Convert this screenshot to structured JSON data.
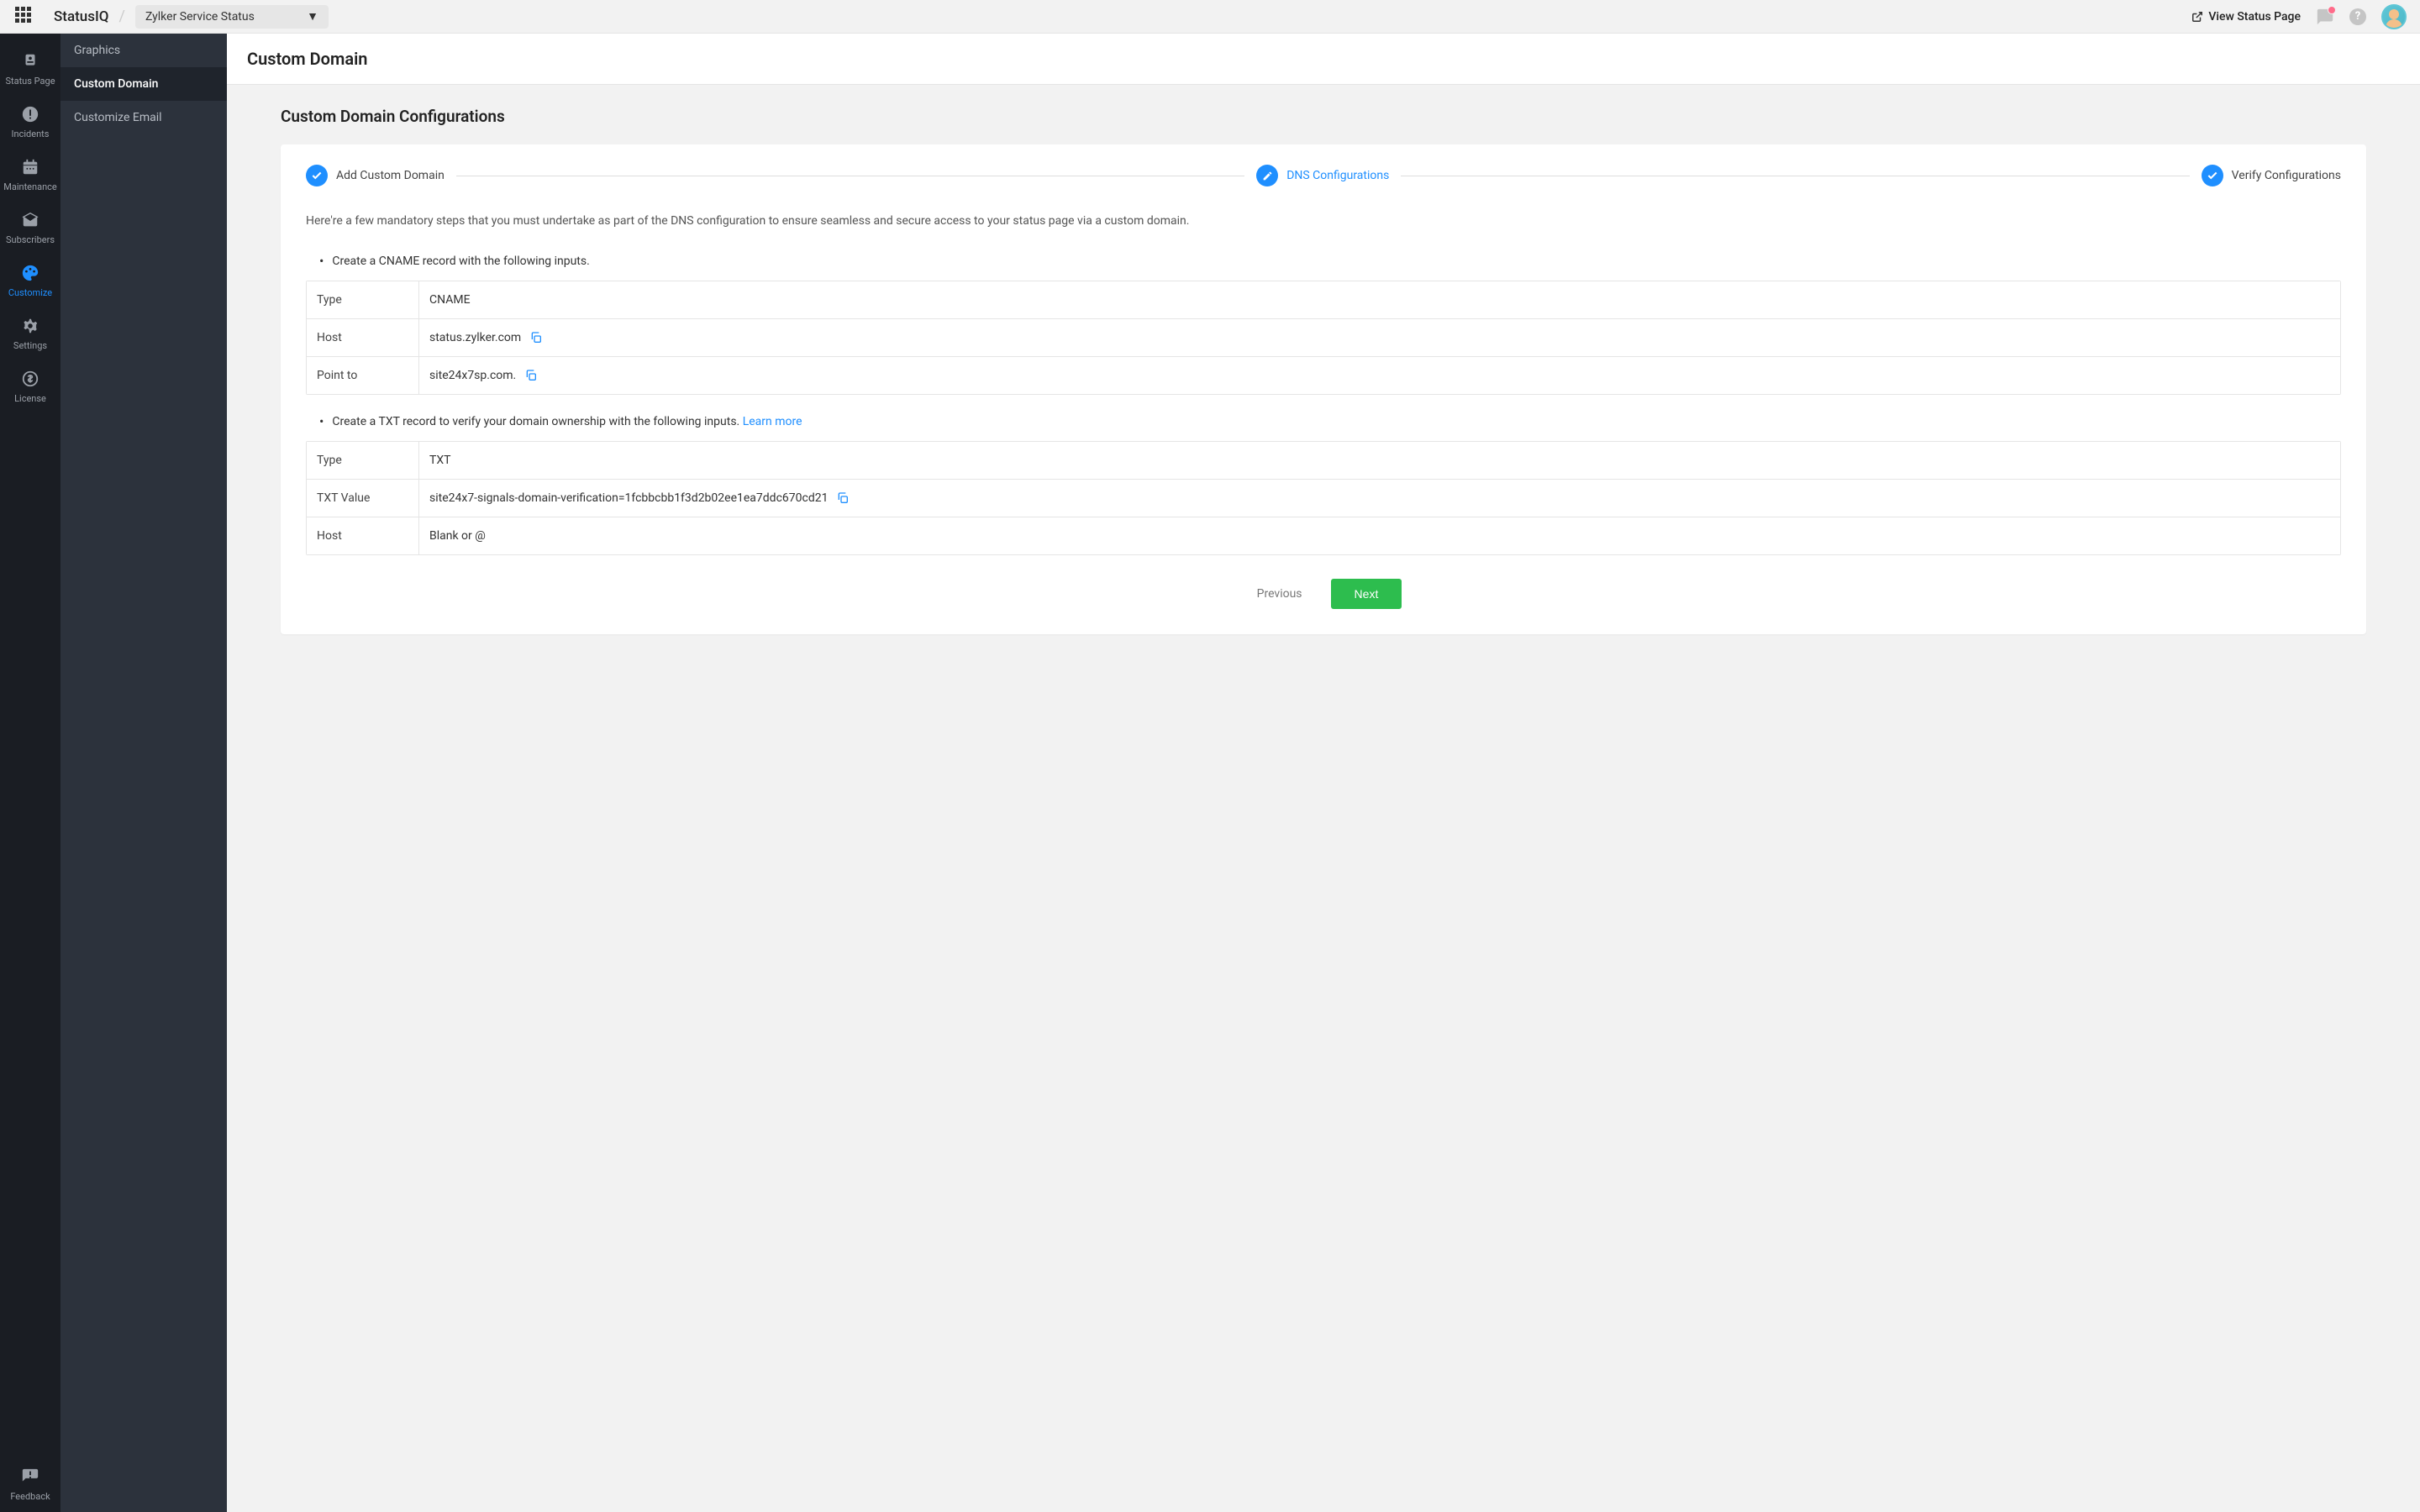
{
  "topbar": {
    "brand": "StatusIQ",
    "page_select": "Zylker Service Status",
    "view_link": "View Status Page"
  },
  "sidebar": {
    "items": [
      {
        "label": "Status Page"
      },
      {
        "label": "Incidents"
      },
      {
        "label": "Maintenance"
      },
      {
        "label": "Subscribers"
      },
      {
        "label": "Customize"
      },
      {
        "label": "Settings"
      },
      {
        "label": "License"
      }
    ],
    "feedback": "Feedback"
  },
  "subnav": {
    "items": [
      "Graphics",
      "Custom Domain",
      "Customize Email"
    ]
  },
  "main": {
    "title": "Custom Domain",
    "section_title": "Custom Domain Configurations",
    "steps": [
      "Add Custom Domain",
      "DNS Configurations",
      "Verify Configurations"
    ],
    "intro": "Here're a few mandatory steps that you must undertake as part of the DNS configuration to ensure seamless and secure access to your status page via a custom domain.",
    "bullet1": "Create a CNAME record with the following inputs.",
    "table1": [
      {
        "key": "Type",
        "val": "CNAME"
      },
      {
        "key": "Host",
        "val": "status.zylker.com"
      },
      {
        "key": "Point to",
        "val": "site24x7sp.com."
      }
    ],
    "bullet2_prefix": "Create a TXT record to verify your domain ownership with the following inputs. ",
    "bullet2_link": "Learn more",
    "table2": [
      {
        "key": "Type",
        "val": "TXT"
      },
      {
        "key": "TXT Value",
        "val": "site24x7-signals-domain-verification=1fcbbcbb1f3d2b02ee1ea7ddc670cd21"
      },
      {
        "key": "Host",
        "val": "Blank or @"
      }
    ],
    "prev": "Previous",
    "next": "Next"
  }
}
